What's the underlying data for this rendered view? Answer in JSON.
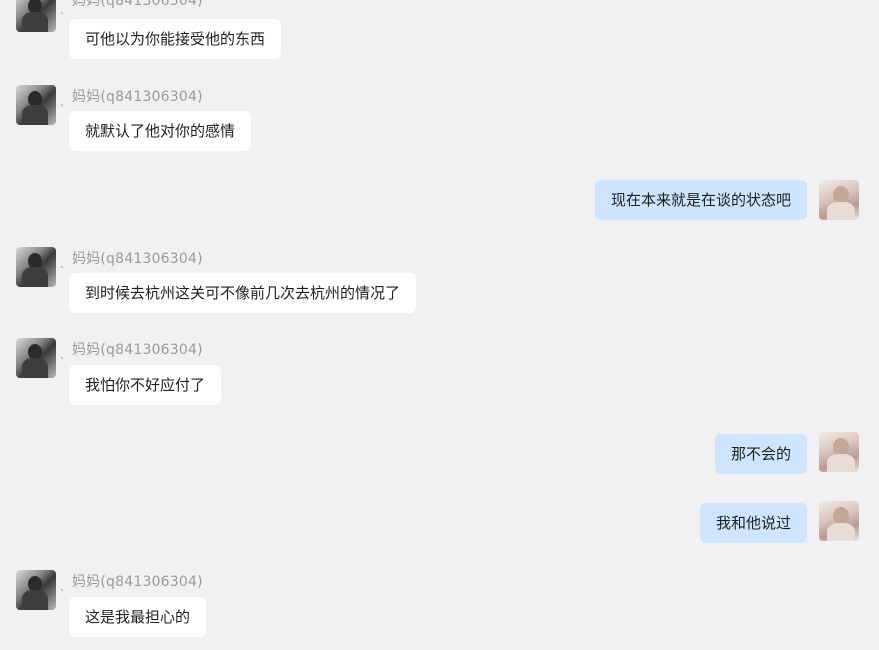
{
  "contacts": {
    "mom_sender_name": "妈妈(q841306304)"
  },
  "messages": [
    {
      "side": "in",
      "text": "可他以为你能接受他的东西"
    },
    {
      "side": "in",
      "text": "就默认了他对你的感情"
    },
    {
      "side": "out",
      "text": "现在本来就是在谈的状态吧"
    },
    {
      "side": "in",
      "text": "到时候去杭州这关可不像前几次去杭州的情况了"
    },
    {
      "side": "in",
      "text": "我怕你不好应付了"
    },
    {
      "side": "out",
      "text": "那不会的"
    },
    {
      "side": "out",
      "text": "我和他说过"
    },
    {
      "side": "in",
      "text": "这是我最担心的"
    }
  ],
  "colors": {
    "background": "#f1f1f3",
    "incoming_bubble": "#ffffff",
    "outgoing_bubble": "#cfe5fd",
    "sender_text": "#9a9a9a"
  }
}
